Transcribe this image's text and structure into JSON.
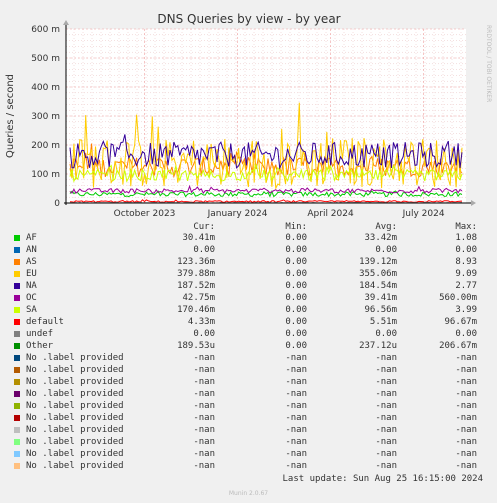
{
  "chart_data": {
    "type": "line",
    "title": "DNS Queries by view - by year",
    "ylabel": "Queries / second",
    "ylim": [
      0,
      600
    ],
    "yticks": [
      {
        "v": 0,
        "label": "0"
      },
      {
        "v": 100,
        "label": "100 m"
      },
      {
        "v": 200,
        "label": "200 m"
      },
      {
        "v": 300,
        "label": "300 m"
      },
      {
        "v": 400,
        "label": "400 m"
      },
      {
        "v": 500,
        "label": "500 m"
      },
      {
        "v": 600,
        "label": "600 m"
      }
    ],
    "xticks": [
      "October 2023",
      "January 2024",
      "April 2024",
      "July 2024"
    ],
    "grid": true,
    "watermark": "RRDTOOL / TOBI OETIKER",
    "series": [
      {
        "name": "AF",
        "color": "#00cc00",
        "level": 30,
        "noise": 8
      },
      {
        "name": "AS",
        "color": "#ff8000",
        "level": 125,
        "noise": 35
      },
      {
        "name": "EU",
        "color": "#ffcc00",
        "level": 140,
        "noise": 90
      },
      {
        "name": "NA",
        "color": "#330099",
        "level": 165,
        "noise": 45
      },
      {
        "name": "OC",
        "color": "#990099",
        "level": 42,
        "noise": 8
      },
      {
        "name": "SA",
        "color": "#ccff00",
        "level": 95,
        "noise": 20
      },
      {
        "name": "default",
        "color": "#ff0000",
        "level": 5,
        "noise": 3
      },
      {
        "name": "Other",
        "color": "#808080",
        "level": 1,
        "noise": 1
      }
    ]
  },
  "legend": {
    "headers": {
      "cur": "Cur:",
      "min": "Min:",
      "avg": "Avg:",
      "max": "Max:"
    },
    "rows": [
      {
        "name": "AF",
        "color": "#00cc00",
        "cur": "30.41m",
        "min": "0.00",
        "avg": "33.42m",
        "max": "1.08"
      },
      {
        "name": "AN",
        "color": "#0066b3",
        "cur": "0.00",
        "min": "0.00",
        "avg": "0.00",
        "max": "0.00"
      },
      {
        "name": "AS",
        "color": "#ff8000",
        "cur": "123.36m",
        "min": "0.00",
        "avg": "139.12m",
        "max": "8.93"
      },
      {
        "name": "EU",
        "color": "#ffcc00",
        "cur": "379.88m",
        "min": "0.00",
        "avg": "355.06m",
        "max": "9.09"
      },
      {
        "name": "NA",
        "color": "#330099",
        "cur": "187.52m",
        "min": "0.00",
        "avg": "184.54m",
        "max": "2.77"
      },
      {
        "name": "OC",
        "color": "#990099",
        "cur": "42.75m",
        "min": "0.00",
        "avg": "39.41m",
        "max": "560.00m"
      },
      {
        "name": "SA",
        "color": "#ccff00",
        "cur": "170.46m",
        "min": "0.00",
        "avg": "96.56m",
        "max": "3.99"
      },
      {
        "name": "default",
        "color": "#ff0000",
        "cur": "4.33m",
        "min": "0.00",
        "avg": "5.51m",
        "max": "96.67m"
      },
      {
        "name": "undef",
        "color": "#808080",
        "cur": "0.00",
        "min": "0.00",
        "avg": "0.00",
        "max": "0.00"
      },
      {
        "name": "Other",
        "color": "#008f00",
        "cur": "189.53u",
        "min": "0.00",
        "avg": "237.12u",
        "max": "206.67m"
      },
      {
        "name": "No .label provided",
        "color": "#00487d",
        "cur": "-nan",
        "min": "-nan",
        "avg": "-nan",
        "max": "-nan"
      },
      {
        "name": "No .label provided",
        "color": "#b35a00",
        "cur": "-nan",
        "min": "-nan",
        "avg": "-nan",
        "max": "-nan"
      },
      {
        "name": "No .label provided",
        "color": "#b38f00",
        "cur": "-nan",
        "min": "-nan",
        "avg": "-nan",
        "max": "-nan"
      },
      {
        "name": "No .label provided",
        "color": "#6b006b",
        "cur": "-nan",
        "min": "-nan",
        "avg": "-nan",
        "max": "-nan"
      },
      {
        "name": "No .label provided",
        "color": "#8fb300",
        "cur": "-nan",
        "min": "-nan",
        "avg": "-nan",
        "max": "-nan"
      },
      {
        "name": "No .label provided",
        "color": "#b30000",
        "cur": "-nan",
        "min": "-nan",
        "avg": "-nan",
        "max": "-nan"
      },
      {
        "name": "No .label provided",
        "color": "#bebebe",
        "cur": "-nan",
        "min": "-nan",
        "avg": "-nan",
        "max": "-nan"
      },
      {
        "name": "No .label provided",
        "color": "#80ff80",
        "cur": "-nan",
        "min": "-nan",
        "avg": "-nan",
        "max": "-nan"
      },
      {
        "name": "No .label provided",
        "color": "#80c9ff",
        "cur": "-nan",
        "min": "-nan",
        "avg": "-nan",
        "max": "-nan"
      },
      {
        "name": "No .label provided",
        "color": "#ffc080",
        "cur": "-nan",
        "min": "-nan",
        "avg": "-nan",
        "max": "-nan"
      }
    ]
  },
  "footer": {
    "last_update": "Last update: Sun Aug 25 16:15:00 2024",
    "munin": "Munin 2.0.67"
  }
}
